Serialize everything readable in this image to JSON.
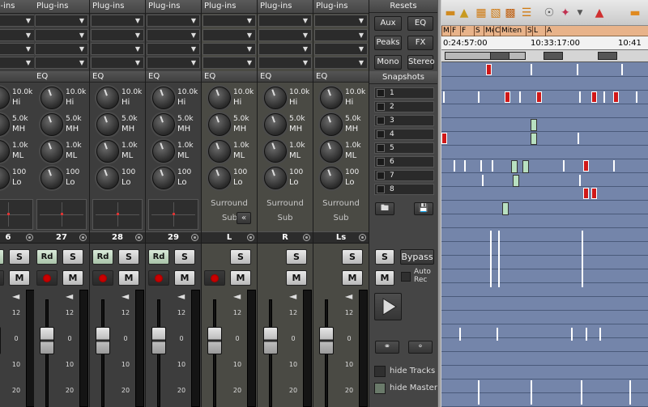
{
  "mixer": {
    "strips": [
      {
        "name": "6",
        "kind": "channel"
      },
      {
        "name": "27",
        "kind": "channel"
      },
      {
        "name": "28",
        "kind": "channel"
      },
      {
        "name": "29",
        "kind": "channel"
      },
      {
        "name": "L",
        "kind": "surround"
      },
      {
        "name": "R",
        "kind": "surround"
      },
      {
        "name": "Ls",
        "kind": "surround"
      }
    ],
    "plugins_label": "Plug-ins",
    "eq_label": "EQ",
    "eq_bands": [
      {
        "value": "10.0k",
        "name": "Hi"
      },
      {
        "value": "5.0k",
        "name": "MH"
      },
      {
        "value": "1.0k",
        "name": "ML"
      },
      {
        "value": "100",
        "name": "Lo"
      }
    ],
    "surround_label": "Surround",
    "sub_label": "Sub",
    "collapse_icon": "double-chevron-left",
    "rd_label": "Rd",
    "solo_label": "S",
    "mute_label": "M",
    "scale": [
      "12",
      "0",
      "10",
      "20",
      "30"
    ]
  },
  "panel": {
    "resets_label": "Resets",
    "aux_label": "Aux",
    "eq_label": "EQ",
    "peaks_label": "Peaks",
    "fx_label": "FX",
    "mono_label": "Mono",
    "stereo_label": "Stereo",
    "snapshots_label": "Snapshots",
    "snapshots": [
      "1",
      "2",
      "3",
      "4",
      "5",
      "6",
      "7",
      "8"
    ],
    "solo_label": "S",
    "bypass_label": "Bypass",
    "mute_label": "M",
    "auto_rec_label1": "Auto",
    "auto_rec_label2": "Rec",
    "hide_tracks_label": "hide Tracks",
    "hide_master_label": "hide Master"
  },
  "arranger": {
    "markers": [
      "M",
      "F",
      "F",
      "S",
      "Me",
      "C",
      "Miten",
      "S",
      "L",
      "A"
    ],
    "ruler": [
      "0:24:57:00",
      "10:33:17:00",
      "10:41"
    ]
  },
  "colors": {
    "arranger_bg": "#7485aa",
    "marker_bar": "#e8b38a",
    "object_red": "#d01818",
    "object_green": "#b8e0c0"
  }
}
